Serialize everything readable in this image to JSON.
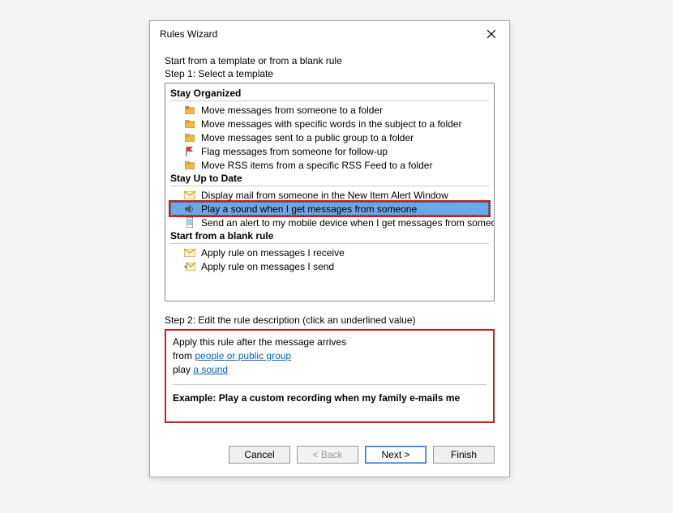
{
  "dialog": {
    "title": "Rules Wizard",
    "intro": "Start from a template or from a blank rule",
    "step1_label": "Step 1: Select a template"
  },
  "sections": {
    "organized": {
      "header": "Stay Organized",
      "items": [
        "Move messages from someone to a folder",
        "Move messages with specific words in the subject to a folder",
        "Move messages sent to a public group to a folder",
        "Flag messages from someone for follow-up",
        "Move RSS items from a specific RSS Feed to a folder"
      ]
    },
    "uptodate": {
      "header": "Stay Up to Date",
      "items": [
        "Display mail from someone in the New Item Alert Window",
        "Play a sound when I get messages from someone",
        "Send an alert to my mobile device when I get messages from someone"
      ]
    },
    "blank": {
      "header": "Start from a blank rule",
      "items": [
        "Apply rule on messages I receive",
        "Apply rule on messages I send"
      ]
    }
  },
  "step2": {
    "label": "Step 2: Edit the rule description (click an underlined value)",
    "line1": "Apply this rule after the message arrives",
    "line2_prefix": "from ",
    "line2_link": "people or public group",
    "line3_prefix": "play ",
    "line3_link": "a sound",
    "example": "Example: Play a custom recording when my family e-mails me"
  },
  "buttons": {
    "cancel": "Cancel",
    "back": "< Back",
    "next": "Next >",
    "finish": "Finish"
  }
}
